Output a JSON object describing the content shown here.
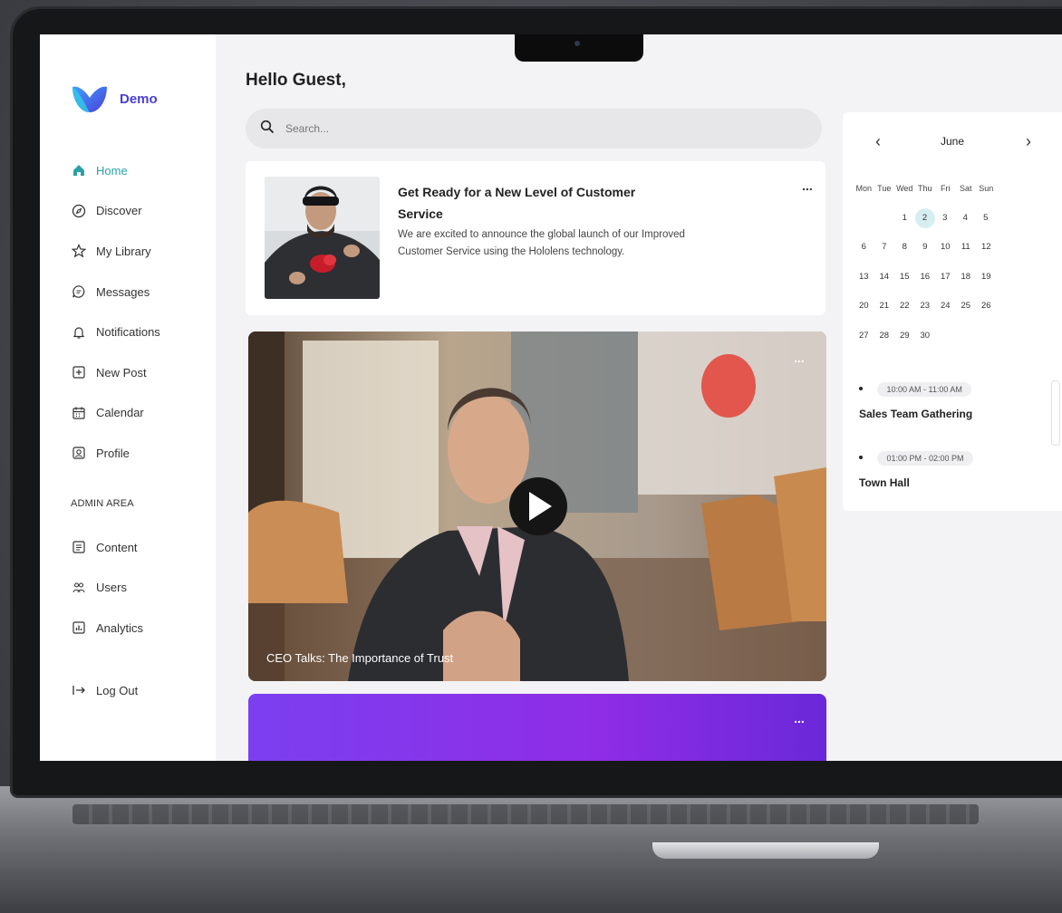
{
  "brand": {
    "name": "Demo"
  },
  "sidebar": {
    "items": [
      {
        "label": "Home",
        "icon": "home-icon",
        "active": true
      },
      {
        "label": "Discover",
        "icon": "compass-icon"
      },
      {
        "label": "My Library",
        "icon": "star-icon"
      },
      {
        "label": "Messages",
        "icon": "message-icon"
      },
      {
        "label": "Notifications",
        "icon": "bell-icon"
      },
      {
        "label": "New Post",
        "icon": "plus-square-icon"
      },
      {
        "label": "Calendar",
        "icon": "calendar-icon"
      },
      {
        "label": "Profile",
        "icon": "profile-icon"
      }
    ],
    "admin_label": "ADMIN AREA",
    "admin_items": [
      {
        "label": "Content",
        "icon": "content-icon"
      },
      {
        "label": "Users",
        "icon": "users-icon"
      },
      {
        "label": "Analytics",
        "icon": "analytics-icon"
      }
    ],
    "logout_label": "Log Out"
  },
  "main": {
    "greeting": "Hello Guest,",
    "search_placeholder": "Search...",
    "news": {
      "title": "Get Ready for a New Level of Customer Service",
      "body": "We are excited to announce the global launch of our Improved Customer Service using the Hololens technology.",
      "more": "..."
    },
    "video": {
      "caption": "CEO Talks: The Importance of Trust",
      "more": "..."
    },
    "promo": {
      "more": "..."
    }
  },
  "calendar": {
    "month": "June",
    "weekdays": [
      "Mon",
      "Tue",
      "Wed",
      "Thu",
      "Fri",
      "Sat",
      "Sun"
    ],
    "weeks": [
      [
        "",
        "",
        "1",
        "2",
        "3",
        "4",
        "5"
      ],
      [
        "6",
        "7",
        "8",
        "9",
        "10",
        "11",
        "12"
      ],
      [
        "13",
        "14",
        "15",
        "16",
        "17",
        "18",
        "19"
      ],
      [
        "20",
        "21",
        "22",
        "23",
        "24",
        "25",
        "26"
      ],
      [
        "27",
        "28",
        "29",
        "30",
        "",
        "",
        ""
      ]
    ],
    "selected": "2",
    "events": [
      {
        "time": "10:00 AM - 11:00 AM",
        "title": "Sales Team Gathering"
      },
      {
        "time": "01:00 PM - 02:00 PM",
        "title": "Town Hall"
      }
    ]
  },
  "colors": {
    "accent": "#2aa0a8",
    "brand": "#4a3fd8",
    "promo": "#7b3ff0"
  }
}
